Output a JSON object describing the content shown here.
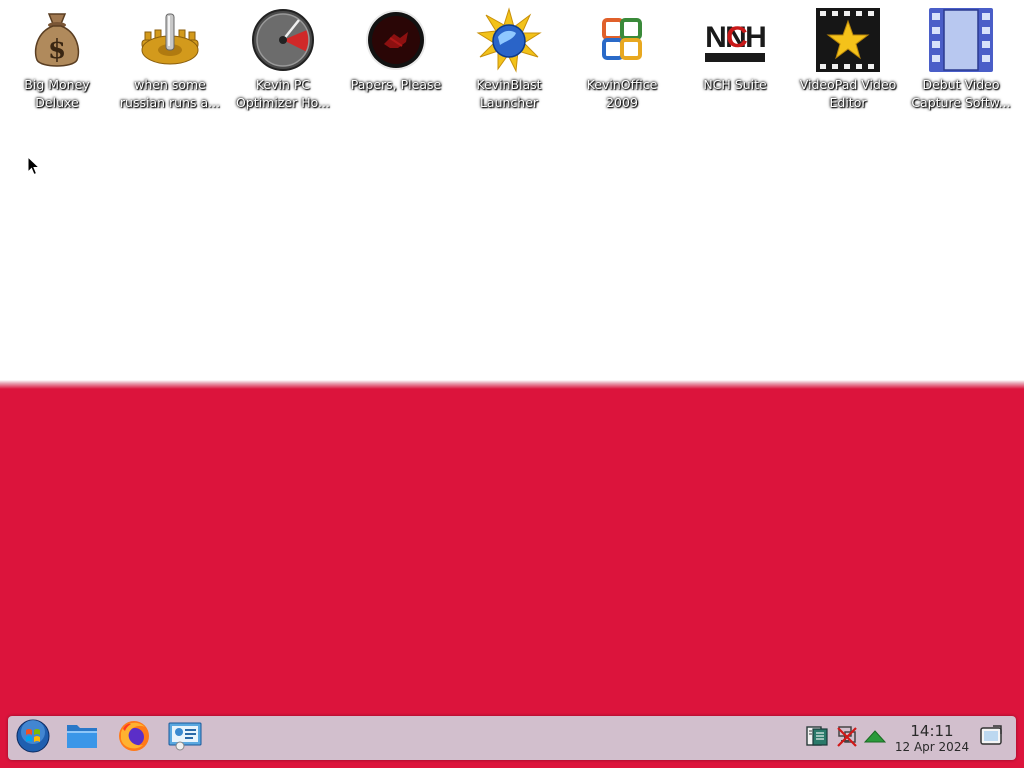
{
  "desktop": {
    "icons": [
      {
        "label": "Big Money\nDeluxe",
        "icon": "money-bag-icon"
      },
      {
        "label": "when some\nrussian runs a...",
        "icon": "joystick-gear-icon"
      },
      {
        "label": "Kevin PC\nOptimizer Ho...",
        "icon": "speedometer-icon"
      },
      {
        "label": "Papers, Please",
        "icon": "papers-please-emblem-icon"
      },
      {
        "label": "KevinBlast\nLauncher",
        "icon": "globe-sunburst-icon"
      },
      {
        "label": "KevinOffice\n2009",
        "icon": "office-logo-icon"
      },
      {
        "label": "NCH Suite",
        "icon": "nch-logo-icon"
      },
      {
        "label": "VideoPad Video\nEditor",
        "icon": "film-star-icon"
      },
      {
        "label": "Debut Video\nCapture Softw...",
        "icon": "film-strip-icon"
      }
    ],
    "wallpaper_colors": {
      "top": "#ffffff",
      "bottom": "#dc143c"
    }
  },
  "taskbar": {
    "launchers": [
      {
        "name": "start-menu",
        "icon": "windows-orb-icon"
      },
      {
        "name": "file-manager",
        "icon": "folder-icon"
      },
      {
        "name": "firefox",
        "icon": "firefox-icon"
      },
      {
        "name": "system-settings",
        "icon": "control-panel-icon"
      }
    ],
    "tray": [
      {
        "name": "clipboard",
        "icon": "clipboard-icon"
      },
      {
        "name": "network-disconnected",
        "icon": "network-off-icon"
      },
      {
        "name": "show-hidden",
        "icon": "arrow-up-icon"
      }
    ],
    "clock": {
      "time": "14:11",
      "date": "12 Apr 2024"
    },
    "background": "#d2bfcd"
  }
}
